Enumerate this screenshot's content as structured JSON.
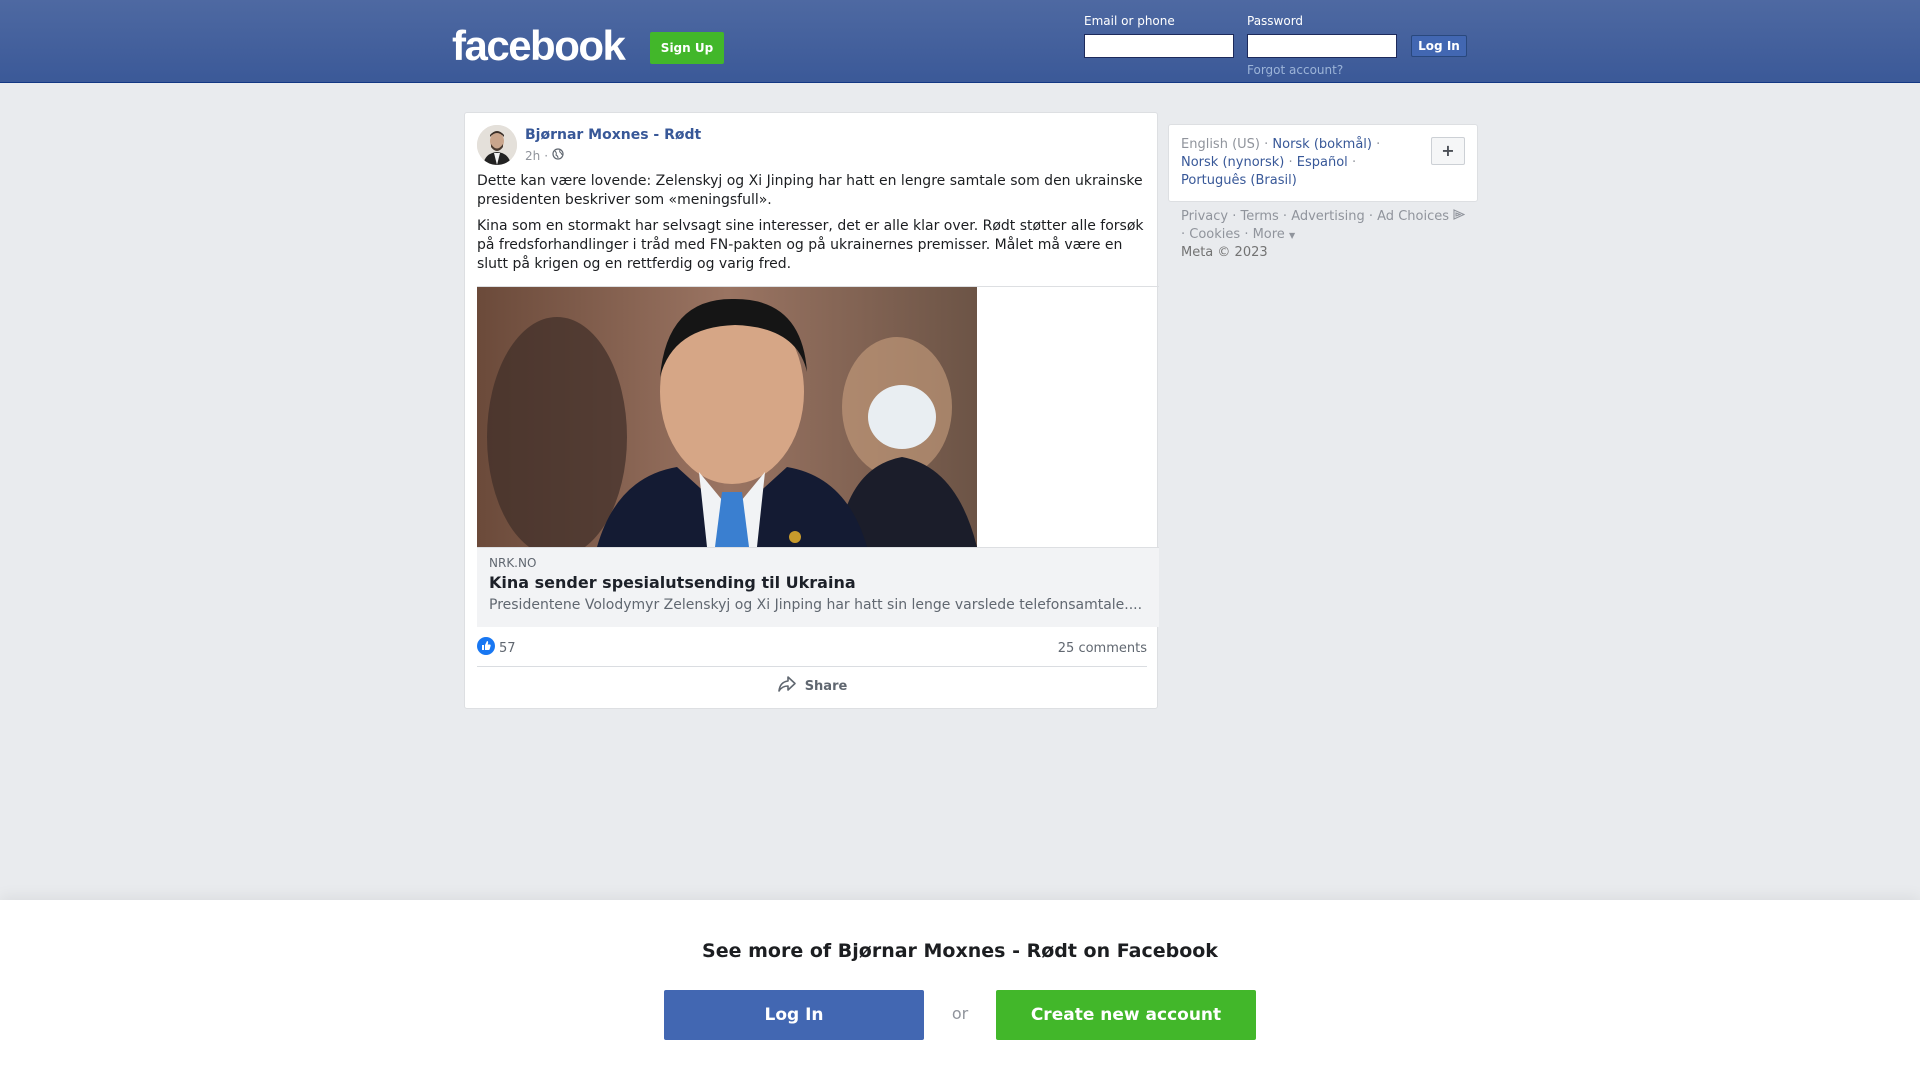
{
  "header": {
    "logo": "facebook",
    "signup_label": "Sign Up",
    "email_label": "Email or phone",
    "email_value": "",
    "password_label": "Password",
    "password_value": "",
    "login_label": "Log In",
    "forgot_label": "Forgot account?"
  },
  "post": {
    "author": "Bjørnar Moxnes - Rødt",
    "time": "2h",
    "audience_icon": "globe-icon",
    "paragraphs": [
      "Dette kan være lovende: Zelenskyj og Xi Jinping har hatt en lengre samtale som den ukrainske presidenten beskriver som «meningsfull».",
      "Kina som en stormakt har selvsagt sine interesser, det er alle klar over. Rødt støtter alle forsøk på fredsforhandlinger i tråd med FN-pakten og på ukrainernes premisser. Målet må være en slutt på krigen og en rettferdig og varig fred."
    ],
    "link": {
      "source": "NRK.NO",
      "title": "Kina sender spesialutsending til Ukraina",
      "description": "Presidentene Volodymyr Zelenskyj og Xi Jinping har hatt sin lenge varslede telefonsamtale...."
    },
    "likes": "57",
    "comments": "25 comments",
    "share_label": "Share"
  },
  "sidebar": {
    "current_language": "English (US)",
    "languages": [
      "Norsk (bokmål)",
      "Norsk (nynorsk)",
      "Español",
      "Português (Brasil)"
    ],
    "footer_links": [
      "Privacy",
      "Terms",
      "Advertising",
      "Ad Choices",
      "Cookies",
      "More"
    ],
    "copyright": "Meta © 2023"
  },
  "banner": {
    "title": "See more of Bjørnar Moxnes - Rødt on Facebook",
    "login_label": "Log In",
    "or_label": "or",
    "create_label": "Create new account"
  },
  "colors": {
    "brand": "#3b5998",
    "green": "#42b72a",
    "link": "#385898"
  }
}
